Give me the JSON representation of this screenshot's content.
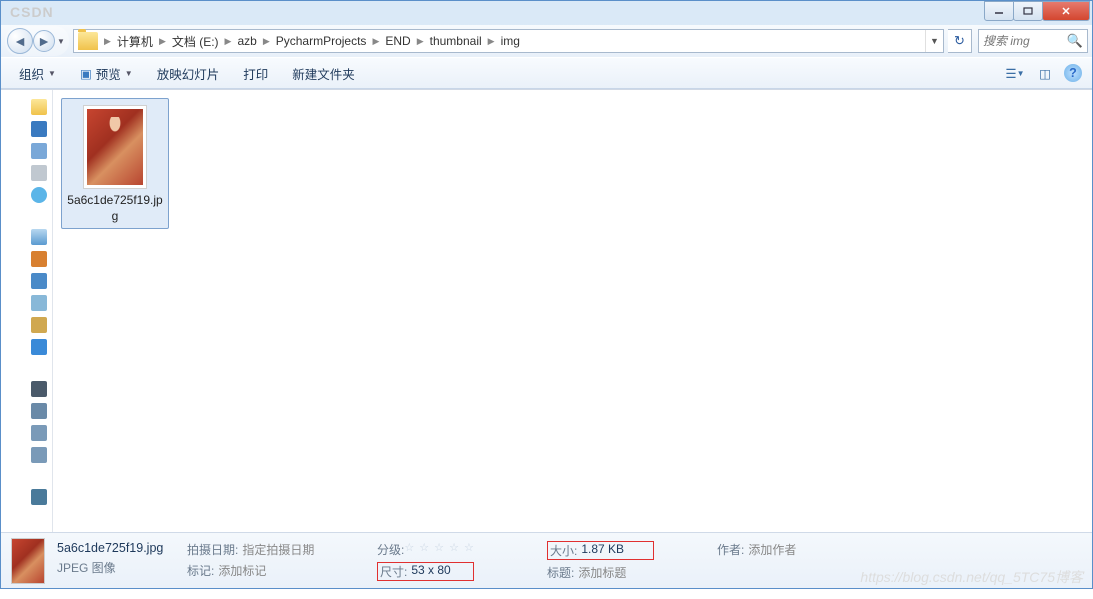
{
  "watermarks": {
    "top": "CSDN",
    "bottom": "https://blog.csdn.net/qq_5TC75博客"
  },
  "window": {
    "breadcrumbs": [
      "计算机",
      "文档 (E:)",
      "azb",
      "PycharmProjects",
      "END",
      "thumbnail",
      "img"
    ],
    "search_placeholder": "搜索 img"
  },
  "toolbar": {
    "organize": "组织",
    "preview": "预览",
    "slideshow": "放映幻灯片",
    "print": "打印",
    "new_folder": "新建文件夹"
  },
  "file": {
    "name": "5a6c1de725f19.jpg"
  },
  "details": {
    "filename": "5a6c1de725f19.jpg",
    "filetype": "JPEG 图像",
    "date_label": "拍摄日期:",
    "date_value": "指定拍摄日期",
    "tags_label": "标记:",
    "tags_value": "添加标记",
    "rating_label": "分级:",
    "dimensions_label": "尺寸:",
    "dimensions_value": "53 x 80",
    "size_label": "大小:",
    "size_value": "1.87 KB",
    "title_label": "标题:",
    "title_value": "添加标题",
    "author_label": "作者:",
    "author_value": "添加作者"
  }
}
